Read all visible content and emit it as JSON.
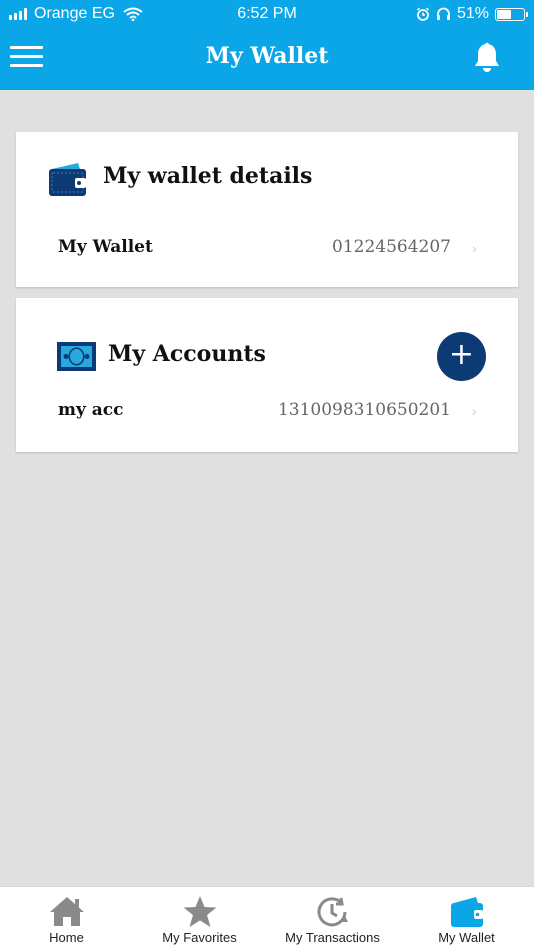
{
  "status_bar": {
    "carrier": "Orange EG",
    "time": "6:52 PM",
    "battery": "51%"
  },
  "header": {
    "title": "My Wallet"
  },
  "wallet_details": {
    "title": "My wallet details",
    "label": "My Wallet",
    "value": "01224564207"
  },
  "accounts": {
    "title": "My Accounts",
    "add_label": "+",
    "items": [
      {
        "name": "my acc",
        "number": "1310098310650201"
      }
    ]
  },
  "tabs": [
    {
      "label": "Home",
      "icon": "home-icon"
    },
    {
      "label": "My Favorites",
      "icon": "star-icon"
    },
    {
      "label": "My Transactions",
      "icon": "clock-icon"
    },
    {
      "label": "My Wallet",
      "icon": "wallet-icon",
      "active": true
    }
  ],
  "colors": {
    "header": "#0aa6e8",
    "accent_dark": "#0b3a75",
    "active_tab": "#0aa6e8"
  }
}
